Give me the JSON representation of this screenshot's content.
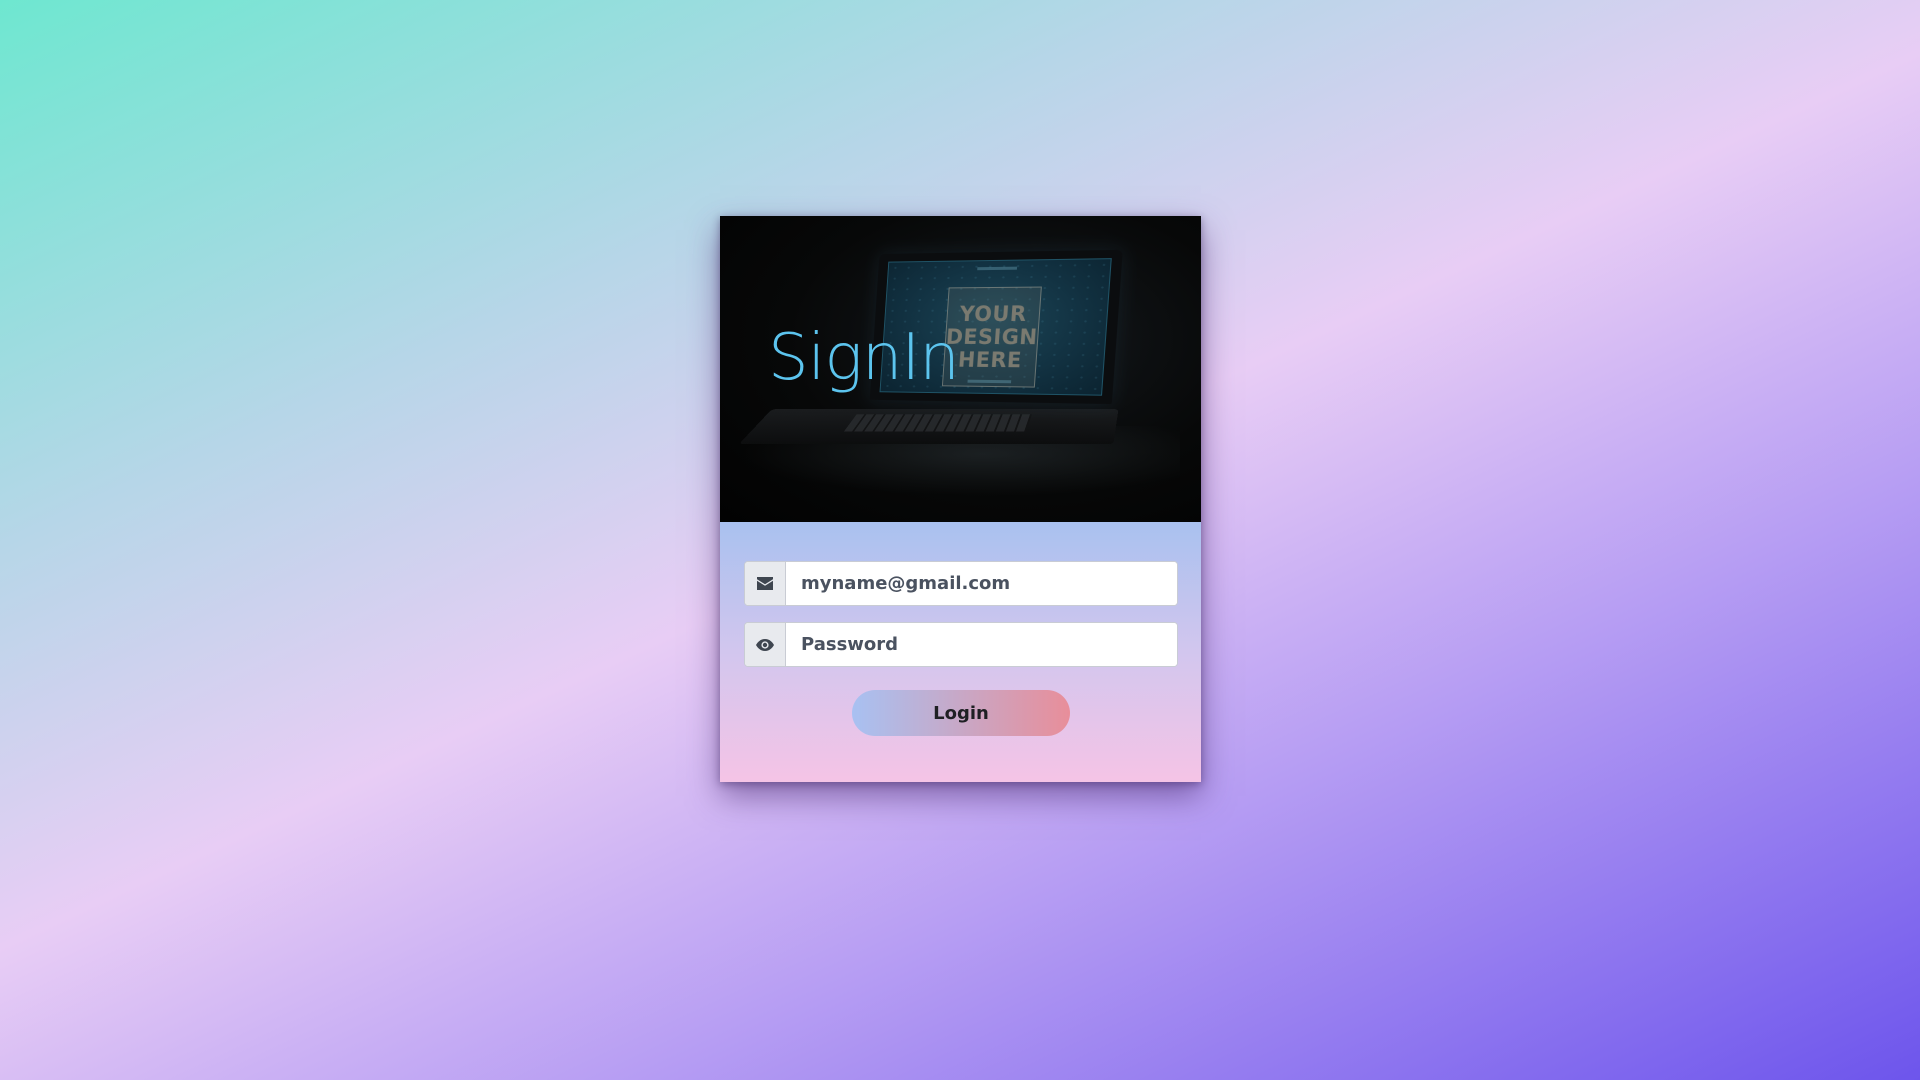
{
  "hero": {
    "title": "SignIn",
    "mockup_text": "YOUR\nDESIGN\nHERE"
  },
  "form": {
    "email": {
      "icon": "envelope-icon",
      "value": "",
      "placeholder": "myname@gmail.com"
    },
    "password": {
      "icon": "eye-icon",
      "value": "",
      "placeholder": "Password"
    },
    "login_label": "Login"
  },
  "colors": {
    "title": "#5cc4ee",
    "button_start": "#a8c1f2",
    "button_end": "#e88e9a"
  }
}
